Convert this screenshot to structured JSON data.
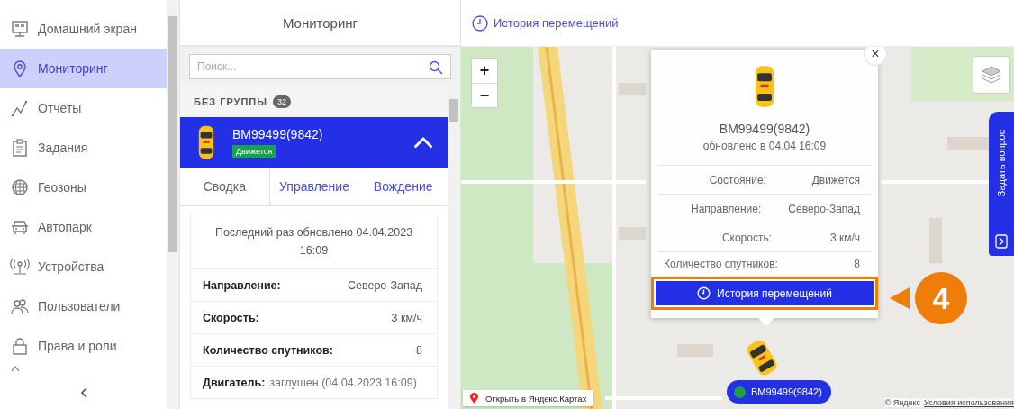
{
  "sidebar": {
    "items": [
      {
        "label": "Домашний экран",
        "selected": false
      },
      {
        "label": "Мониторинг",
        "selected": true
      },
      {
        "label": "Отчеты",
        "selected": false
      },
      {
        "label": "Задания",
        "selected": false
      },
      {
        "label": "Геозоны",
        "selected": false
      },
      {
        "label": "Автопарк",
        "selected": false
      },
      {
        "label": "Устройства",
        "selected": false
      },
      {
        "label": "Пользователи",
        "selected": false
      },
      {
        "label": "Права и роли",
        "selected": false
      }
    ]
  },
  "panel": {
    "title": "Мониторинг",
    "search": {
      "placeholder": "Поиск..."
    },
    "group": {
      "label": "БЕЗ ГРУППЫ",
      "count": "32"
    },
    "vehicle": {
      "name": "BM99499(9842)",
      "status": "Движется",
      "expanded": true
    },
    "tabs": [
      {
        "label": "Сводка",
        "selected": true
      },
      {
        "label": "Управление",
        "selected": false
      },
      {
        "label": "Вождение",
        "selected": false
      }
    ],
    "updated": "Последний раз обновлено 04.04.2023 16:09",
    "rows": [
      {
        "kind": "pair",
        "label": "Направление:",
        "value": "Северо-Запад"
      },
      {
        "kind": "pair",
        "label": "Скорость:",
        "value": "3 км/ч"
      },
      {
        "kind": "pair",
        "label": "Количество спутников:",
        "value": "8"
      },
      {
        "kind": "inline",
        "label": "Двигатель:",
        "value": "заглушен (04.04.2023 16:09)"
      }
    ]
  },
  "map": {
    "history_link": "История перемещений",
    "zoom_in": "+",
    "zoom_out": "−",
    "popup": {
      "close": "×",
      "name": "BM99499(9842)",
      "updated": "обновлено в 04.04 16:09",
      "rows": [
        {
          "label": "Состояние:",
          "value": "Движется"
        },
        {
          "label": "Направление:",
          "value": "Северо-Запад"
        },
        {
          "label": "Скорость:",
          "value": "3 км/ч"
        },
        {
          "label": "Количество спутников:",
          "value": "8"
        }
      ],
      "button": "История перемещений"
    },
    "marker": {
      "name": "BM99499(9842)",
      "color": "#1e9e4a"
    },
    "open_link": "Открыть в Яндекс.Картах",
    "copyright": "© Яндекс",
    "terms": "Условия использования",
    "ask_tab": "Задать вопрос",
    "callout": "4"
  }
}
